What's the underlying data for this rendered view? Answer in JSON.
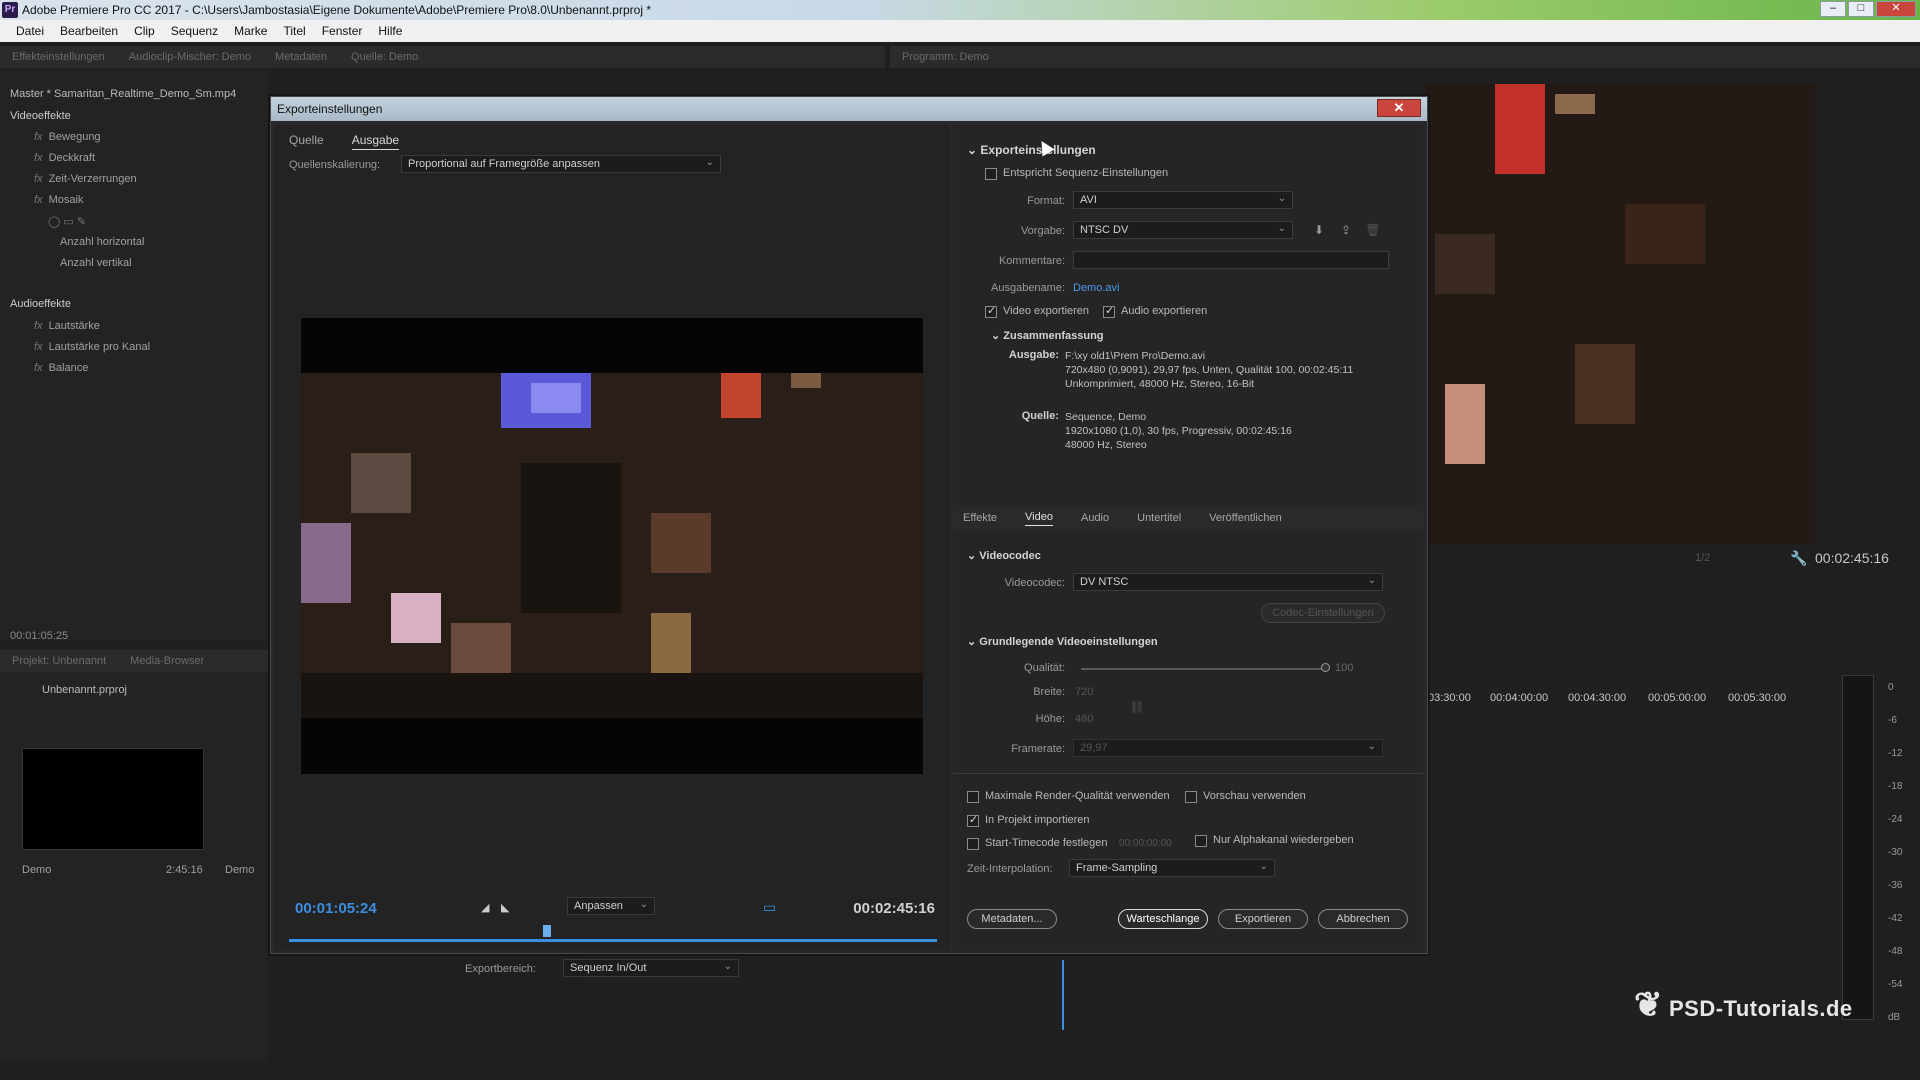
{
  "window": {
    "title": "Adobe Premiere Pro CC 2017 - C:\\Users\\Jambostasia\\Eigene Dokumente\\Adobe\\Premiere Pro\\8.0\\Unbenannt.prproj *",
    "app_icon": "Pr"
  },
  "menu": [
    "Datei",
    "Bearbeiten",
    "Clip",
    "Sequenz",
    "Marke",
    "Titel",
    "Fenster",
    "Hilfe"
  ],
  "top_panels": {
    "tabs": [
      "Effekteinstellungen",
      "Audioclip-Mischer: Demo",
      "Metadaten",
      "Quelle: Demo"
    ],
    "program_tab": "Programm: Demo",
    "master": "Master * Samaritan_Realtime_Demo_Sm.mp4"
  },
  "effects": {
    "video_header": "Videoeffekte",
    "video_items": [
      "Bewegung",
      "Deckkraft",
      "Zeit-Verzerrungen",
      "Mosaik"
    ],
    "mosaik_params": [
      "Anzahl horizontal",
      "Anzahl vertikal"
    ],
    "audio_header": "Audioeffekte",
    "audio_items": [
      "Lautstärke",
      "Lautstärke pro Kanal",
      "Balance"
    ],
    "timecode": "00:01:05:25"
  },
  "project": {
    "tabs": [
      "Projekt: Unbenannt",
      "Media-Browser"
    ],
    "file": "Unbenannt.prproj",
    "clips": [
      {
        "name": "Demo",
        "duration": "2:45:16"
      },
      {
        "name": "Demo",
        "duration": ""
      }
    ]
  },
  "program": {
    "fraction": "1/2",
    "timecode": "00:02:45:16"
  },
  "timeline": {
    "ruler": [
      "03:30:00",
      "00:04:00:00",
      "00:04:30:00",
      "00:05:00:00",
      "00:05:30:00"
    ]
  },
  "meter": {
    "labels": [
      "0",
      "-6",
      "-12",
      "-18",
      "-24",
      "-30",
      "-36",
      "-42",
      "-48",
      "-54",
      "dB"
    ]
  },
  "dialog": {
    "title": "Exporteinstellungen",
    "left_tabs": [
      "Quelle",
      "Ausgabe"
    ],
    "scaling_label": "Quellenskalierung:",
    "scaling_value": "Proportional auf Framegröße anpassen",
    "tc_current": "00:01:05:24",
    "tc_end": "00:02:45:16",
    "fit_value": "Anpassen",
    "range_label": "Exportbereich:",
    "range_value": "Sequenz In/Out",
    "export_section": "Exporteinstellungen",
    "match_seq": "Entspricht Sequenz-Einstellungen",
    "format_label": "Format:",
    "format_value": "AVI",
    "preset_label": "Vorgabe:",
    "preset_value": "NTSC DV",
    "comments_label": "Kommentare:",
    "comments_value": "",
    "output_name_label": "Ausgabename:",
    "output_name_value": "Demo.avi",
    "export_video": "Video exportieren",
    "export_audio": "Audio exportieren",
    "summary_header": "Zusammenfassung",
    "summary_output_key": "Ausgabe:",
    "summary_output_lines": [
      "F:\\xy old1\\Prem Pro\\Demo.avi",
      "720x480 (0,9091), 29,97 fps, Unten, Qualität 100, 00:02:45:11",
      "Unkomprimiert, 48000 Hz, Stereo, 16-Bit"
    ],
    "summary_source_key": "Quelle:",
    "summary_source_lines": [
      "Sequence, Demo",
      "1920x1080 (1,0), 30 fps, Progressiv, 00:02:45:16",
      "48000 Hz, Stereo"
    ],
    "right_tabs": [
      "Effekte",
      "Video",
      "Audio",
      "Untertitel",
      "Veröffentlichen"
    ],
    "codec_section": "Videocodec",
    "codec_label": "Videocodec:",
    "codec_value": "DV NTSC",
    "codec_settings": "Codec-Einstellungen",
    "basic_section": "Grundlegende Videoeinstellungen",
    "quality_label": "Qualität:",
    "quality_value": "100",
    "quality_level": 1.0,
    "width_label": "Breite:",
    "width_value": "720",
    "height_label": "Höhe:",
    "height_value": "480",
    "framerate_label": "Framerate:",
    "framerate_value": "29,97",
    "max_render": "Maximale Render-Qualität verwenden",
    "use_preview": "Vorschau verwenden",
    "import_project": "In Projekt importieren",
    "start_tc": "Start-Timecode festlegen",
    "start_tc_value": "00:00:00:00",
    "alpha_only": "Nur Alphakanal wiedergeben",
    "interp_label": "Zeit-Interpolation:",
    "interp_value": "Frame-Sampling",
    "btn_metadata": "Metadaten...",
    "btn_queue": "Warteschlange",
    "btn_export": "Exportieren",
    "btn_cancel": "Abbrechen"
  },
  "watermark": "PSD-Tutorials.de",
  "colors": {
    "accent_blue": "#3b8ee0",
    "link_blue": "#4a9be8",
    "close_red": "#c9463d"
  }
}
